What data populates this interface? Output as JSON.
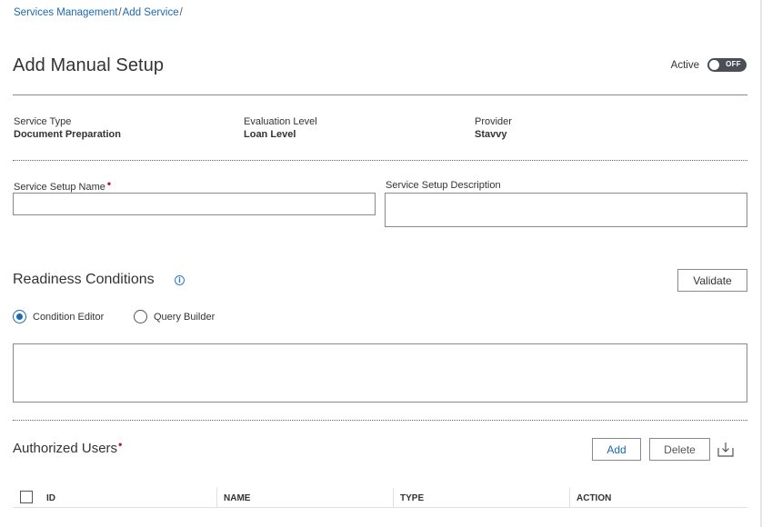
{
  "breadcrumb": {
    "items": [
      "Services Management",
      "Add Service"
    ],
    "separator": "/"
  },
  "page": {
    "title": "Add Manual Setup",
    "active_label": "Active",
    "toggle_text": "OFF"
  },
  "info": [
    {
      "label": "Service Type",
      "value": "Document Preparation"
    },
    {
      "label": "Evaluation Level",
      "value": "Loan Level"
    },
    {
      "label": "Provider",
      "value": "Stavvy"
    }
  ],
  "form": {
    "setup_name_label": "Service Setup Name",
    "setup_name_value": "",
    "setup_description_label": "Service Setup Description",
    "setup_description_value": "",
    "required_mark": "•"
  },
  "readiness": {
    "title": "Readiness Conditions",
    "info_icon": "info-circle-icon",
    "validate_label": "Validate",
    "options": [
      {
        "label": "Condition Editor",
        "selected": true
      },
      {
        "label": "Query Builder",
        "selected": false
      }
    ]
  },
  "authorized_users": {
    "title": "Authorized Users",
    "add_label": "Add",
    "delete_label": "Delete",
    "export_icon": "export-icon",
    "columns": [
      "ID",
      "NAME",
      "TYPE",
      "ACTION"
    ]
  },
  "colors": {
    "link": "#1a6ab0",
    "required": "#c0182f",
    "toggle_off": "#4a4f57"
  }
}
